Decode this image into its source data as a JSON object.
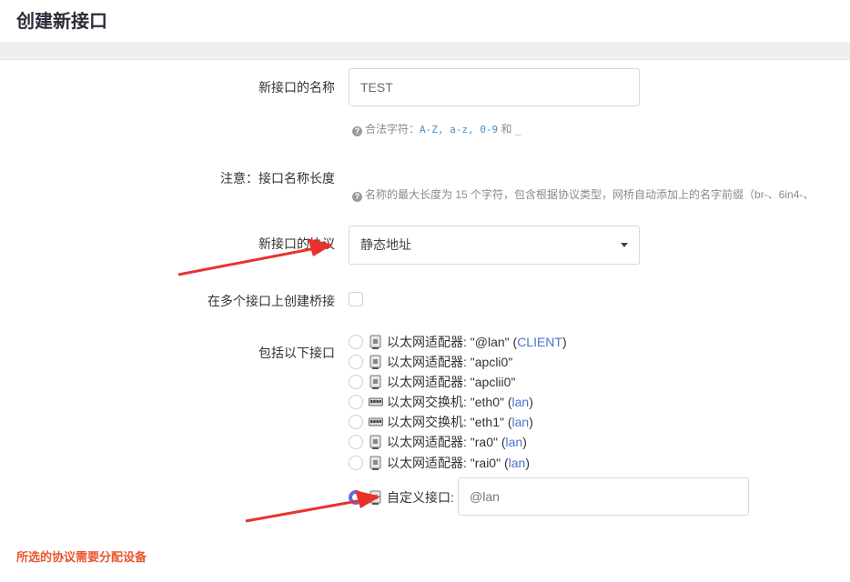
{
  "page": {
    "title": "创建新接口"
  },
  "form": {
    "name": {
      "label": "新接口的名称",
      "value": "TEST"
    },
    "name_hint": {
      "prefix": "合法字符：",
      "chars": "A-Z, a-z, 0-9",
      "and": " 和 ",
      "underscore": "_"
    },
    "note": {
      "label": "注意：接口名称长度",
      "hint": "名称的最大长度为 15 个字符，包含根据协议类型，网桥自动添加上的名字前缀（br-、6in4-、"
    },
    "protocol": {
      "label": "新接口的协议",
      "selected": "静态地址"
    },
    "bridge": {
      "label": "在多个接口上创建桥接",
      "checked": false
    },
    "include": {
      "label": "包括以下接口",
      "interfaces": [
        {
          "text": "以太网适配器: \"@lan\"",
          "zone": "CLIENT",
          "icon": "ethernet-adapter-icon"
        },
        {
          "text": "以太网适配器: \"apcli0\"",
          "zone": "",
          "icon": "ethernet-adapter-icon"
        },
        {
          "text": "以太网适配器: \"apclii0\"",
          "zone": "",
          "icon": "ethernet-adapter-icon"
        },
        {
          "text": "以太网交换机: \"eth0\"",
          "zone": "lan",
          "icon": "ethernet-switch-icon"
        },
        {
          "text": "以太网交换机: \"eth1\"",
          "zone": "lan",
          "icon": "ethernet-switch-icon"
        },
        {
          "text": "以太网适配器: \"ra0\"",
          "zone": "lan",
          "icon": "ethernet-adapter-icon"
        },
        {
          "text": "以太网适配器: \"rai0\"",
          "zone": "lan",
          "icon": "ethernet-adapter-icon"
        }
      ],
      "custom": {
        "label": "自定义接口:",
        "value": "@lan",
        "selected": true
      }
    }
  },
  "error": "所选的协议需要分配设备",
  "colors": {
    "accent": "#5b6fe6",
    "error": "#e8572d",
    "arrow": "#e8322d",
    "zone_link": "#4c73c9"
  }
}
